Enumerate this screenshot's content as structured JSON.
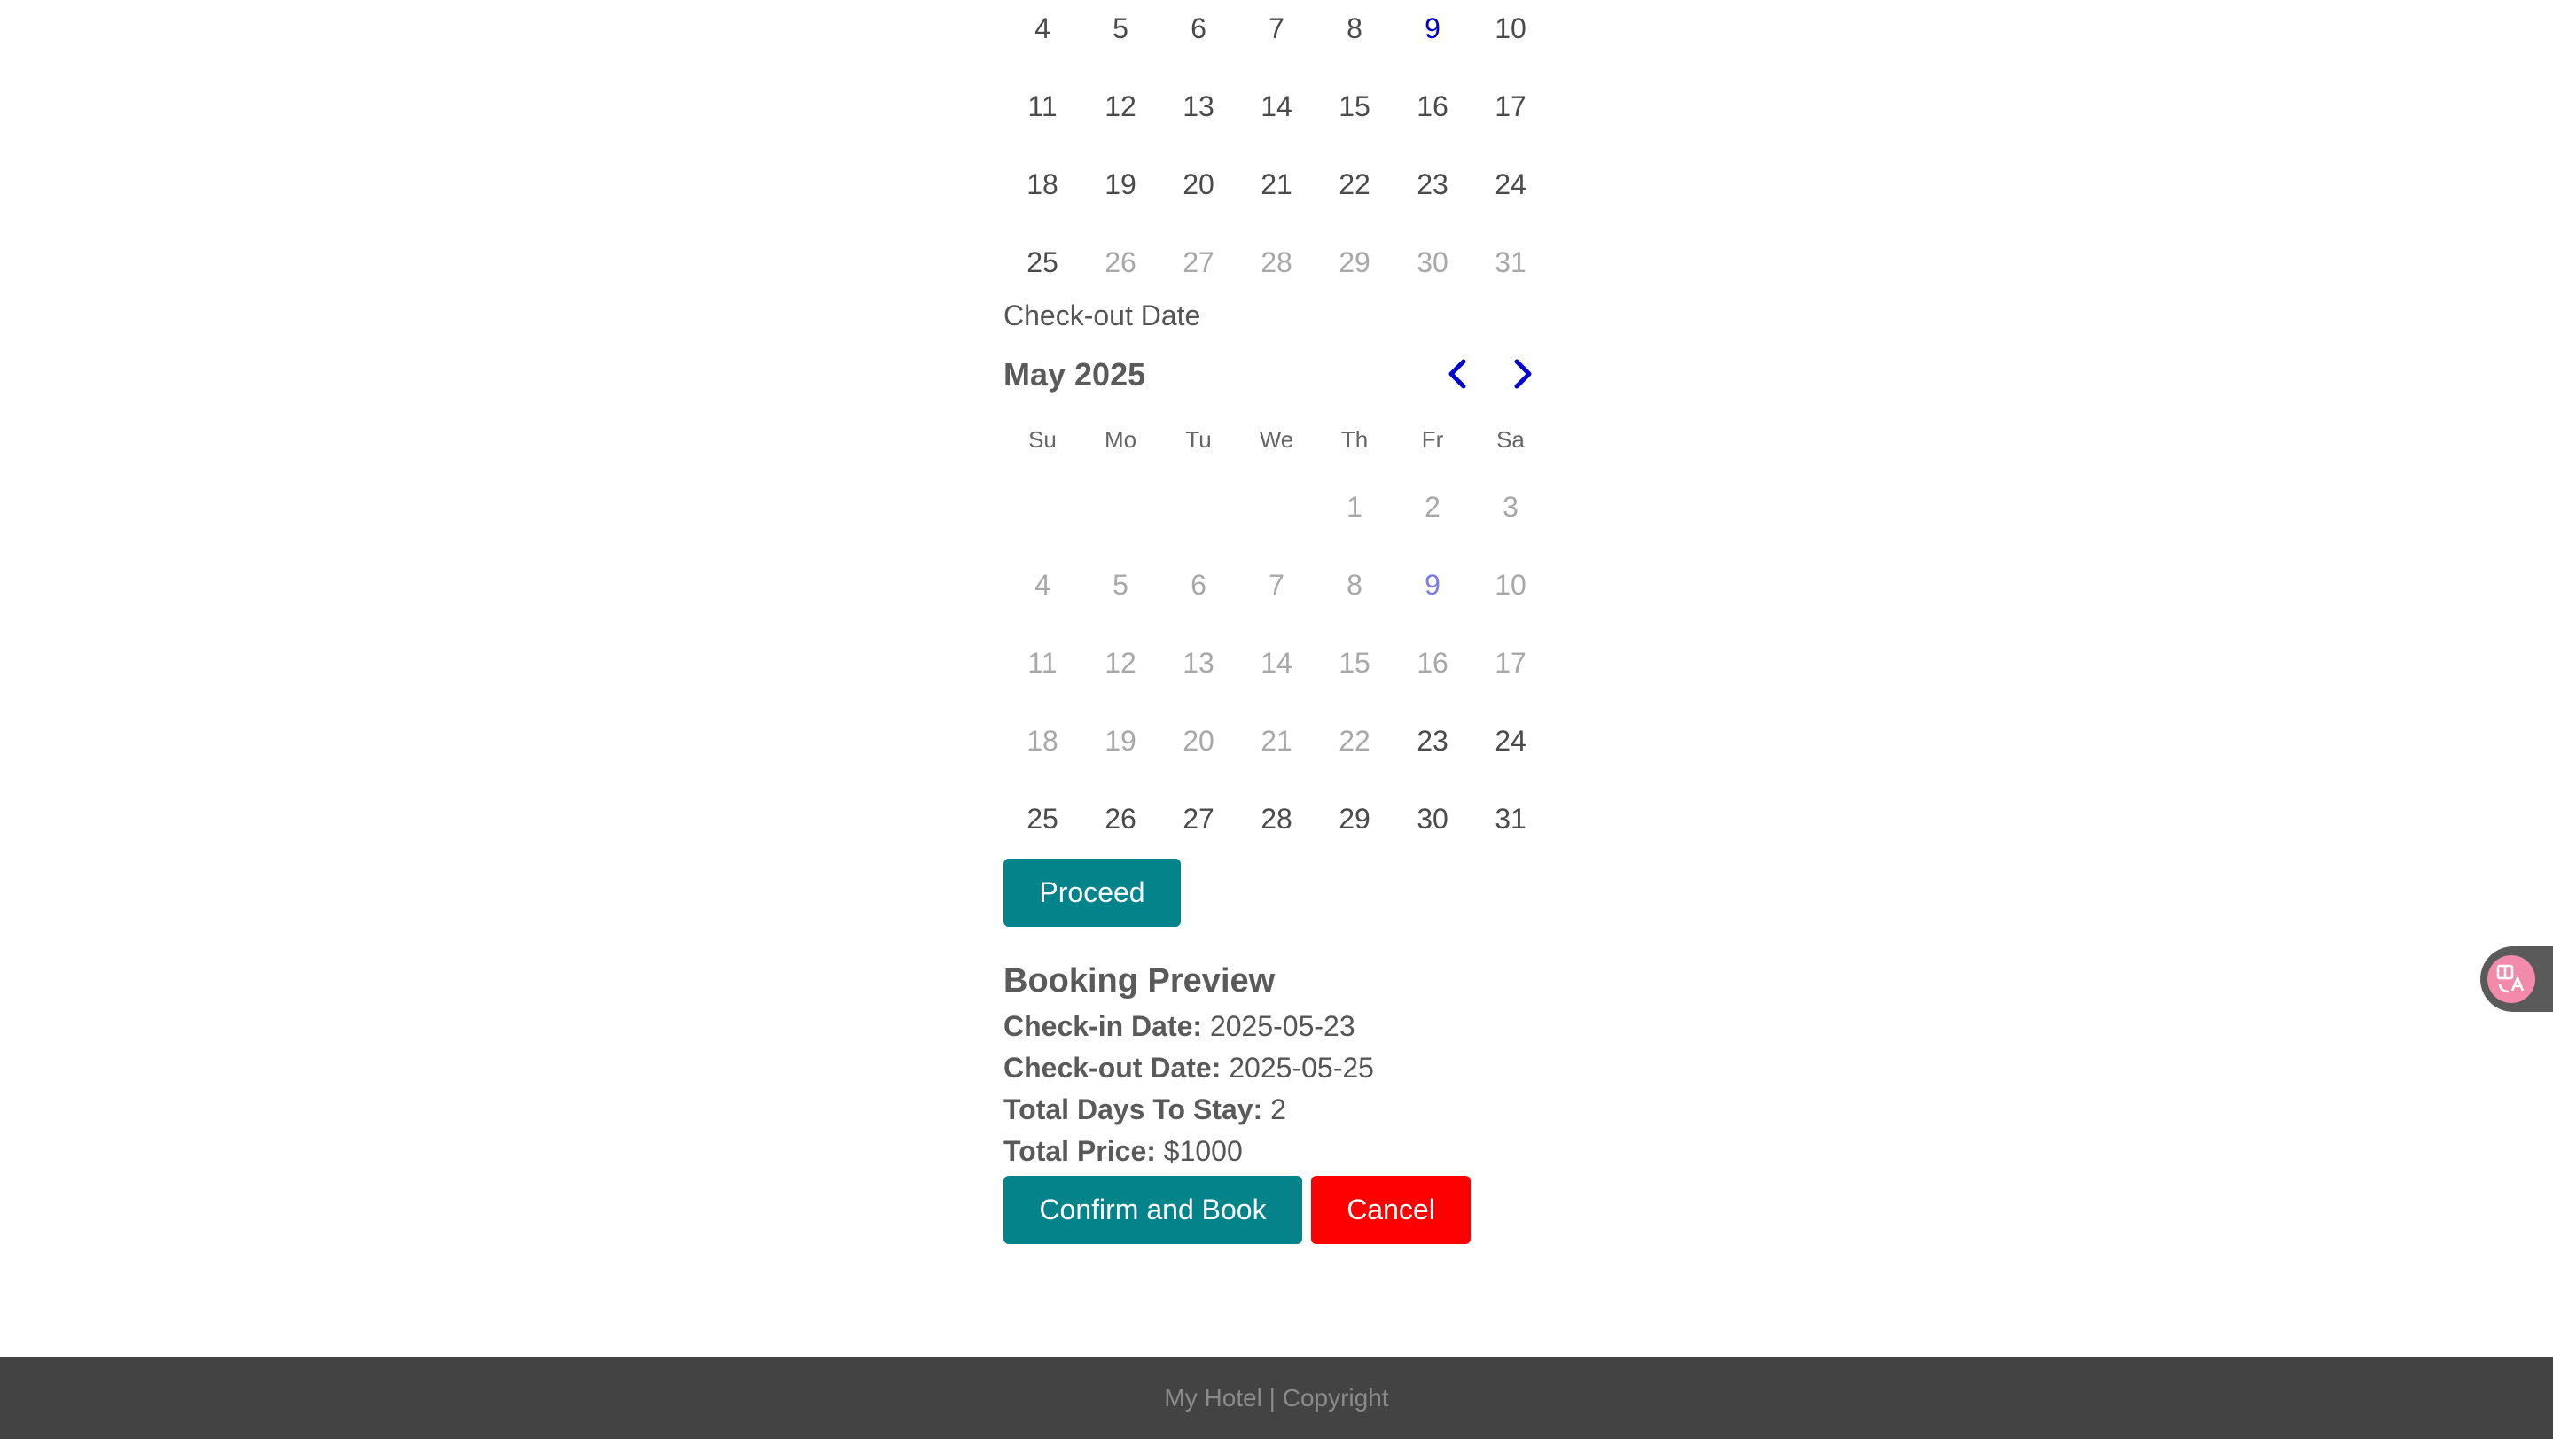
{
  "checkin_calendar": {
    "week_rows": [
      [
        {
          "d": "4",
          "s": "normal"
        },
        {
          "d": "5",
          "s": "normal"
        },
        {
          "d": "6",
          "s": "normal"
        },
        {
          "d": "7",
          "s": "normal"
        },
        {
          "d": "8",
          "s": "normal"
        },
        {
          "d": "9",
          "s": "today"
        },
        {
          "d": "10",
          "s": "normal"
        }
      ],
      [
        {
          "d": "11",
          "s": "normal"
        },
        {
          "d": "12",
          "s": "normal"
        },
        {
          "d": "13",
          "s": "normal"
        },
        {
          "d": "14",
          "s": "normal"
        },
        {
          "d": "15",
          "s": "normal"
        },
        {
          "d": "16",
          "s": "normal"
        },
        {
          "d": "17",
          "s": "normal"
        }
      ],
      [
        {
          "d": "18",
          "s": "normal"
        },
        {
          "d": "19",
          "s": "normal"
        },
        {
          "d": "20",
          "s": "normal"
        },
        {
          "d": "21",
          "s": "normal"
        },
        {
          "d": "22",
          "s": "normal"
        },
        {
          "d": "23",
          "s": "normal"
        },
        {
          "d": "24",
          "s": "normal"
        }
      ],
      [
        {
          "d": "25",
          "s": "normal"
        },
        {
          "d": "26",
          "s": "muted"
        },
        {
          "d": "27",
          "s": "muted"
        },
        {
          "d": "28",
          "s": "muted"
        },
        {
          "d": "29",
          "s": "muted"
        },
        {
          "d": "30",
          "s": "muted"
        },
        {
          "d": "31",
          "s": "muted"
        }
      ]
    ]
  },
  "checkout": {
    "label": "Check-out Date",
    "month_label": "May 2025",
    "prev_icon": "chevron-left-icon",
    "next_icon": "chevron-right-icon",
    "weekdays": [
      "Su",
      "Mo",
      "Tu",
      "We",
      "Th",
      "Fr",
      "Sa"
    ],
    "week_rows": [
      [
        {
          "d": "",
          "s": "empty"
        },
        {
          "d": "",
          "s": "empty"
        },
        {
          "d": "",
          "s": "empty"
        },
        {
          "d": "",
          "s": "empty"
        },
        {
          "d": "1",
          "s": "muted"
        },
        {
          "d": "2",
          "s": "muted"
        },
        {
          "d": "3",
          "s": "muted"
        }
      ],
      [
        {
          "d": "4",
          "s": "muted"
        },
        {
          "d": "5",
          "s": "muted"
        },
        {
          "d": "6",
          "s": "muted"
        },
        {
          "d": "7",
          "s": "muted"
        },
        {
          "d": "8",
          "s": "muted"
        },
        {
          "d": "9",
          "s": "today-muted"
        },
        {
          "d": "10",
          "s": "muted"
        }
      ],
      [
        {
          "d": "11",
          "s": "muted"
        },
        {
          "d": "12",
          "s": "muted"
        },
        {
          "d": "13",
          "s": "muted"
        },
        {
          "d": "14",
          "s": "muted"
        },
        {
          "d": "15",
          "s": "muted"
        },
        {
          "d": "16",
          "s": "muted"
        },
        {
          "d": "17",
          "s": "muted"
        }
      ],
      [
        {
          "d": "18",
          "s": "muted"
        },
        {
          "d": "19",
          "s": "muted"
        },
        {
          "d": "20",
          "s": "muted"
        },
        {
          "d": "21",
          "s": "muted"
        },
        {
          "d": "22",
          "s": "muted"
        },
        {
          "d": "23",
          "s": "normal"
        },
        {
          "d": "24",
          "s": "normal"
        }
      ],
      [
        {
          "d": "25",
          "s": "normal"
        },
        {
          "d": "26",
          "s": "normal"
        },
        {
          "d": "27",
          "s": "normal"
        },
        {
          "d": "28",
          "s": "normal"
        },
        {
          "d": "29",
          "s": "normal"
        },
        {
          "d": "30",
          "s": "normal"
        },
        {
          "d": "31",
          "s": "normal"
        }
      ]
    ]
  },
  "actions": {
    "proceed_label": "Proceed",
    "confirm_label": "Confirm and Book",
    "cancel_label": "Cancel"
  },
  "preview": {
    "title": "Booking Preview",
    "checkin_label": "Check-in Date:",
    "checkin_value": "2025-05-23",
    "checkout_label": "Check-out Date:",
    "checkout_value": "2025-05-25",
    "days_label": "Total Days To Stay:",
    "days_value": "2",
    "price_label": "Total Price:",
    "price_value": "$1000"
  },
  "footer": {
    "text": "My Hotel | Copyright"
  },
  "translate_widget": {
    "icon": "translate-icon"
  },
  "colors": {
    "accent_teal": "#04838a",
    "cancel_red": "#ff0000",
    "today_blue": "#0000d0",
    "footer_bg": "#434343"
  }
}
